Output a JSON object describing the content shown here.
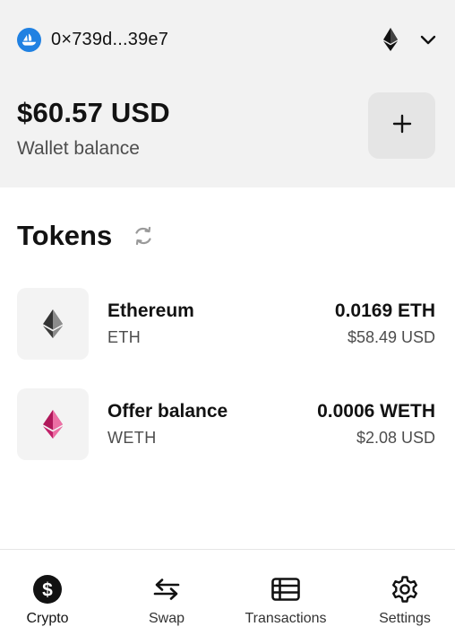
{
  "header": {
    "account_address": "0×739d...39e7",
    "network_icon": "ethereum-icon",
    "dropdown_icon": "chevron-down-icon"
  },
  "wallet": {
    "balance": "$60.57 USD",
    "balance_label": "Wallet balance",
    "add_button_symbol": "+"
  },
  "tokens": {
    "title": "Tokens",
    "refresh_icon": "refresh-icon",
    "items": [
      {
        "name": "Ethereum",
        "symbol": "ETH",
        "amount": "0.0169 ETH",
        "usd": "$58.49 USD",
        "icon": "ethereum-icon",
        "color": "#3c3c3d"
      },
      {
        "name": "Offer balance",
        "symbol": "WETH",
        "amount": "0.0006 WETH",
        "usd": "$2.08 USD",
        "icon": "weth-icon",
        "color": "#ec4d8c"
      }
    ]
  },
  "nav": {
    "items": [
      {
        "label": "Crypto",
        "icon": "dollar-icon",
        "active": true
      },
      {
        "label": "Swap",
        "icon": "swap-arrows-icon",
        "active": false
      },
      {
        "label": "Transactions",
        "icon": "list-table-icon",
        "active": false
      },
      {
        "label": "Settings",
        "icon": "gear-icon",
        "active": false
      }
    ]
  },
  "colors": {
    "accent": "#2081e2",
    "header_bg": "#f2f2f2",
    "text_primary": "#121212",
    "text_secondary": "#4d4d4d"
  }
}
